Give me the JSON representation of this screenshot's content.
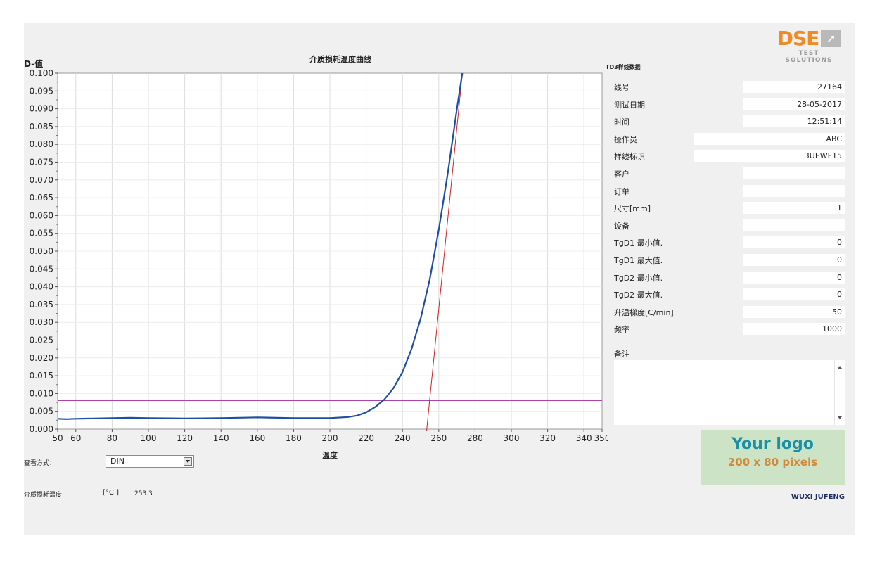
{
  "chart": {
    "title": "介质损耗温度曲线",
    "ylabel": "D-值",
    "xlabel": "温度"
  },
  "chart_data": {
    "type": "line",
    "xlim": [
      50,
      350
    ],
    "ylim": [
      0,
      0.1
    ],
    "x_ticks": [
      50,
      60,
      80,
      100,
      120,
      140,
      160,
      180,
      200,
      220,
      240,
      260,
      280,
      300,
      320,
      340,
      350
    ],
    "y_ticks": [
      "0.000",
      "0.005",
      "0.010",
      "0.015",
      "0.020",
      "0.025",
      "0.030",
      "0.035",
      "0.040",
      "0.045",
      "0.050",
      "0.055",
      "0.060",
      "0.065",
      "0.070",
      "0.075",
      "0.080",
      "0.085",
      "0.090",
      "0.095",
      "0.100"
    ],
    "grid": true,
    "series": [
      {
        "color": "#1f4fa0",
        "x": [
          50,
          55,
          60,
          70,
          80,
          90,
          100,
          120,
          140,
          160,
          180,
          200,
          210,
          215,
          220,
          225,
          230,
          235,
          240,
          245,
          250,
          255,
          260,
          265,
          270,
          273
        ],
        "y": [
          0.0029,
          0.0028,
          0.0029,
          0.003,
          0.0031,
          0.0032,
          0.0031,
          0.003,
          0.0031,
          0.0033,
          0.0031,
          0.0031,
          0.0034,
          0.0038,
          0.0047,
          0.0062,
          0.0083,
          0.0115,
          0.016,
          0.0225,
          0.031,
          0.042,
          0.056,
          0.072,
          0.09,
          0.1
        ]
      },
      {
        "color": "#cc2222",
        "x": [
          253.3,
          273
        ],
        "y": [
          -0.0005,
          0.1
        ]
      },
      {
        "color": "#aa44aa",
        "x": [
          50,
          350
        ],
        "y": [
          0.008,
          0.008
        ]
      }
    ]
  },
  "view": {
    "label": "查看方式：",
    "selected": "DIN"
  },
  "dissipation_temp": {
    "label": "介质损耗温度",
    "unit": "[°C ]",
    "value": "253.3"
  },
  "info": {
    "title": "TD3样线数据",
    "rows": [
      {
        "label": "线号",
        "value": "27164"
      },
      {
        "label": "测试日期",
        "value": "28-05-2017"
      },
      {
        "label": "时间",
        "value": "12:51:14"
      },
      {
        "label": "操作员",
        "value": "ABC"
      },
      {
        "label": "样线标识",
        "value": "3UEWF15"
      },
      {
        "label": "客户",
        "value": ""
      },
      {
        "label": "订单",
        "value": ""
      },
      {
        "label": "尺寸[mm]",
        "value": "1"
      },
      {
        "label": "设备",
        "value": ""
      },
      {
        "label": "TgD1 最小值.",
        "value": "0"
      },
      {
        "label": "TgD1 最大值.",
        "value": "0"
      },
      {
        "label": "TgD2 最小值.",
        "value": "0"
      },
      {
        "label": "TgD2 最大值.",
        "value": "0"
      },
      {
        "label": "升温梯度[C/min]",
        "value": "50"
      },
      {
        "label": "频率",
        "value": "1000"
      }
    ],
    "notes_label": "备注"
  },
  "brand": {
    "logo_text": "DSE",
    "logo_sub": "TEST SOLUTIONS",
    "logo_color": "#f08a24",
    "placeholder_line1": "Your logo",
    "placeholder_line2": "200 x 80 pixels",
    "company": "WUXI JUFENG"
  }
}
